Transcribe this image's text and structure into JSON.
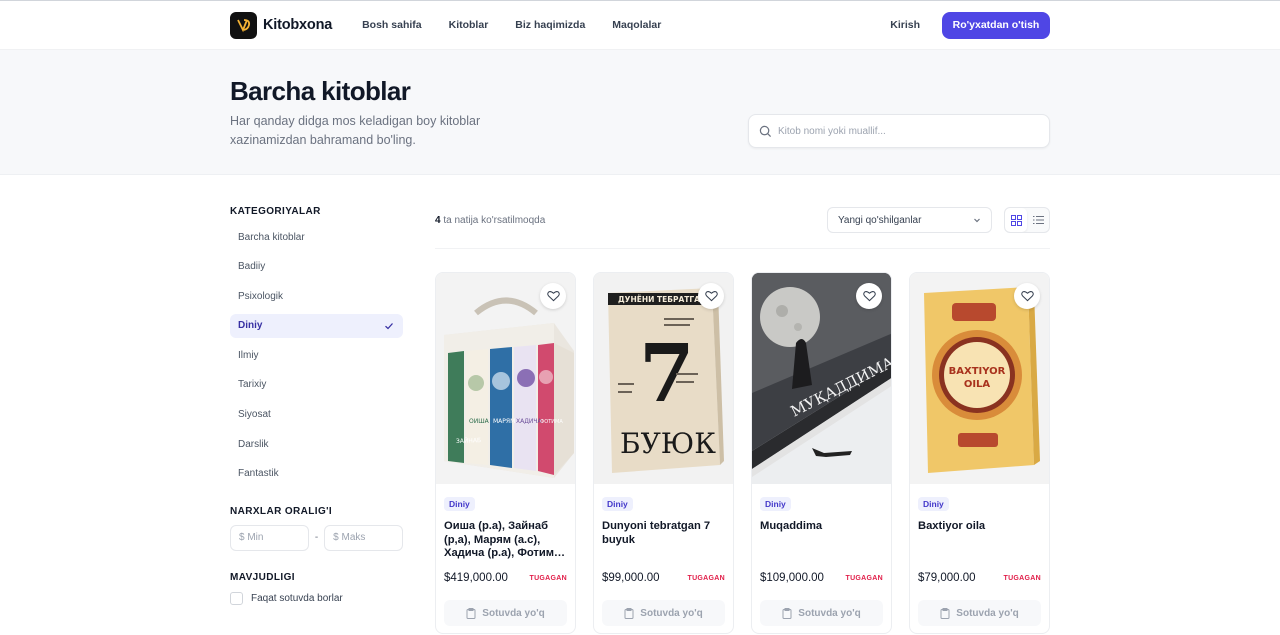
{
  "brand": {
    "name": "Kitobxona",
    "accent": "#4f46e5"
  },
  "nav": {
    "items": [
      "Bosh sahifa",
      "Kitoblar",
      "Biz haqimizda",
      "Maqolalar"
    ],
    "login": "Kirish",
    "register": "Ro'yxatdan o'tish"
  },
  "hero": {
    "title": "Barcha kitoblar",
    "subtitle": "Har qanday didga mos keladigan boy kitoblar xazinamizdan bahramand bo'ling."
  },
  "search": {
    "placeholder": "Kitob nomi yoki muallif..."
  },
  "sidebar": {
    "categories_title": "KATEGORIYALAR",
    "categories": [
      "Barcha kitoblar",
      "Badiiy",
      "Psixologik",
      "Diniy",
      "Ilmiy",
      "Tarixiy",
      "Siyosat",
      "Darslik",
      "Fantastik"
    ],
    "active_category": "Diniy",
    "price_title": "NARXLAR ORALIG'I",
    "price_min_placeholder": "$ Min",
    "price_max_placeholder": "$ Maks",
    "availability_title": "MAVJUDLIGI",
    "availability_option": "Faqat sotuvda borlar"
  },
  "toolbar": {
    "result_count": "4",
    "result_text": " ta natija ko'rsatilmoqda",
    "sort_value": "Yangi qo'shilganlar"
  },
  "products": [
    {
      "category": "Diniy",
      "title": "Оиша (р.а), Зайнаб (р,а), Марям (а.с), Хадича (р.а), Фотима (р.а)",
      "price": "$419,000.00",
      "status": "TUGAGAN",
      "button": "Sotuvda yo'q"
    },
    {
      "category": "Diniy",
      "title": "Dunyoni tebratgan 7 buyuk",
      "price": "$99,000.00",
      "status": "TUGAGAN",
      "button": "Sotuvda yo'q"
    },
    {
      "category": "Diniy",
      "title": "Muqaddima",
      "price": "$109,000.00",
      "status": "TUGAGAN",
      "button": "Sotuvda yo'q"
    },
    {
      "category": "Diniy",
      "title": "Baxtiyor oila",
      "price": "$79,000.00",
      "status": "TUGAGAN",
      "button": "Sotuvda yo'q"
    }
  ],
  "covers": {
    "book2_header": "ДУНЁНИ ТЕБРАТГАН",
    "book2_number": "7",
    "book2_word": "БУЮК",
    "book3_title": "МУҚАДДИМА",
    "book4_title_line1": "BAXTIYOR",
    "book4_title_line2": "OILA",
    "book1_spines": [
      "ЗАЙНАБ",
      "ОИША",
      "МАРЯМ",
      "ХАДИЧА",
      "ФОТИМА"
    ]
  }
}
